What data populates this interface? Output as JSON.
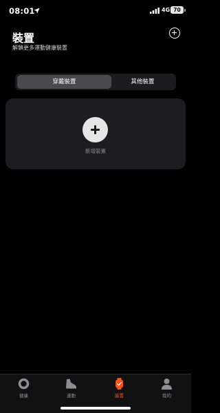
{
  "status_bar": {
    "time": "08:01",
    "network": "4G",
    "battery": "70"
  },
  "header": {
    "title": "裝置",
    "subtitle": "解鎖更多運動健康裝置"
  },
  "segments": [
    {
      "label": "穿戴裝置",
      "selected": true
    },
    {
      "label": "其他裝置",
      "selected": false
    }
  ],
  "card": {
    "add_label": "新增裝置"
  },
  "tabs": [
    {
      "label": "健康",
      "icon": "health-ring-icon"
    },
    {
      "label": "運動",
      "icon": "shoe-icon"
    },
    {
      "label": "裝置",
      "icon": "watch-icon",
      "active": true
    },
    {
      "label": "我的",
      "icon": "person-icon"
    }
  ],
  "colors": {
    "accent": "#ff4f1a",
    "background": "#000000",
    "card": "#1d1d1f"
  }
}
